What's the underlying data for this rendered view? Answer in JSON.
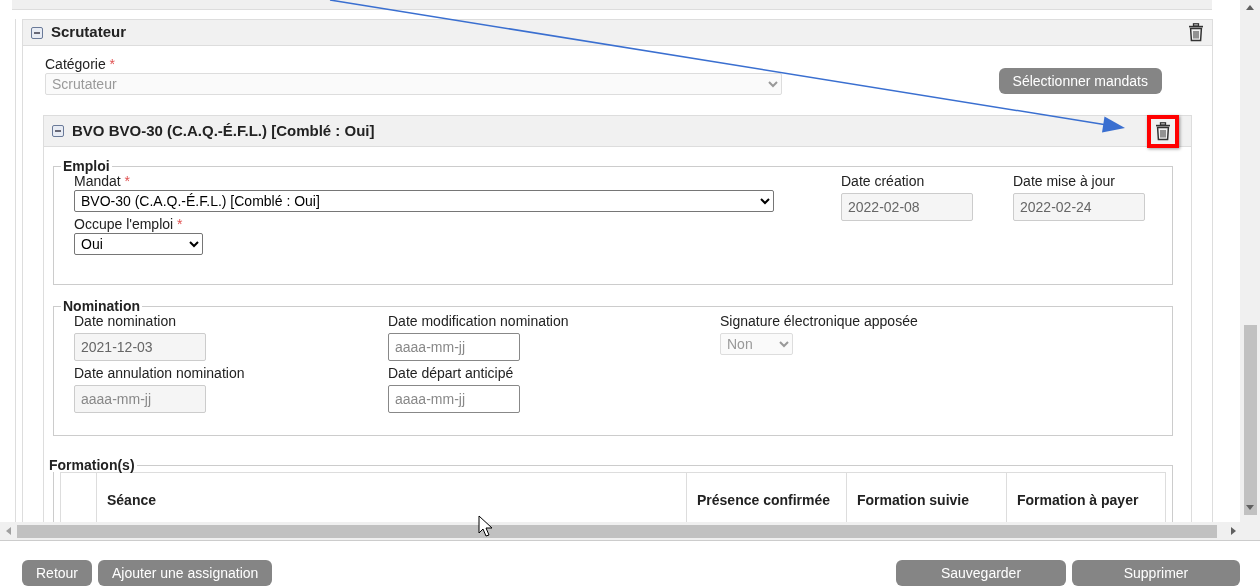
{
  "section": {
    "title": "Scrutateur",
    "expanded": true,
    "category": {
      "label": "Catégorie",
      "required_mark": "*",
      "value": "Scrutateur",
      "disabled": true
    },
    "select_button": "Sélectionner mandats",
    "mandate": {
      "title": "BVO BVO-30 (C.A.Q.-É.F.L.) [Comblé : Oui]",
      "expanded": true,
      "delete_highlighted": true,
      "emploi": {
        "legend": "Emploi",
        "left": [
          {
            "label": "Mandat",
            "required_mark": "*",
            "kind": "select",
            "value": "BVO-30 (C.A.Q.-É.F.L.) [Comblé : Oui]",
            "disabled": false
          },
          {
            "label": "Occupe l'emploi",
            "required_mark": "*",
            "kind": "select",
            "value": "Oui",
            "disabled": false
          }
        ],
        "right": [
          {
            "label": "Date création",
            "kind": "date",
            "value": "2022-02-08",
            "disabled": true
          },
          {
            "label": "Date mise à jour",
            "kind": "date",
            "value": "2022-02-24",
            "disabled": true
          }
        ]
      },
      "nomination": {
        "legend": "Nomination",
        "rows": [
          [
            {
              "label": "Date nomination",
              "kind": "date",
              "value": "2021-12-03",
              "disabled": true
            },
            {
              "label": "Date modification nomination",
              "kind": "date",
              "placeholder": "aaaa-mm-jj",
              "disabled": false
            },
            {
              "label": "Signature électronique apposée",
              "kind": "select",
              "value": "Non",
              "disabled": true
            }
          ],
          [
            {
              "label": "Date annulation nomination",
              "kind": "date",
              "placeholder": "aaaa-mm-jj",
              "disabled": true
            },
            {
              "label": "Date départ anticipé",
              "kind": "date",
              "placeholder": "aaaa-mm-jj",
              "disabled": false
            }
          ]
        ]
      },
      "formations": {
        "legend": "Formation(s)",
        "columns": [
          "Séance",
          "Présence confirmée",
          "Formation suivie",
          "Formation à payer"
        ]
      }
    }
  },
  "footer": {
    "left_buttons": [
      "Retour",
      "Ajouter une assignation"
    ],
    "right_buttons": [
      "Sauvegarder",
      "Supprimer"
    ]
  }
}
